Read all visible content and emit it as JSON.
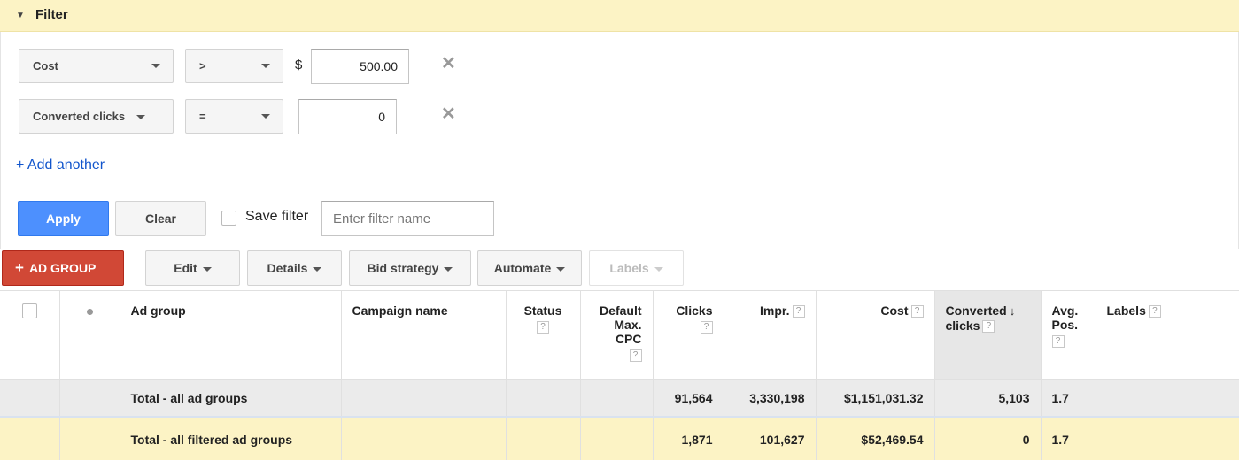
{
  "filter": {
    "title": "Filter",
    "rows": [
      {
        "field": "Cost",
        "operator": ">",
        "prefix": "$",
        "value": "500.00"
      },
      {
        "field": "Converted clicks",
        "operator": "=",
        "prefix": "",
        "value": "0"
      }
    ],
    "remove_glyph": "✕",
    "add_another": "+ Add another",
    "apply_label": "Apply",
    "clear_label": "Clear",
    "save_filter_label": "Save filter",
    "filter_name_placeholder": "Enter filter name"
  },
  "toolbar": {
    "add_ad_group": "AD GROUP",
    "add_icon": "+",
    "edit": "Edit",
    "details": "Details",
    "bid_strategy": "Bid strategy",
    "automate": "Automate",
    "labels": "Labels"
  },
  "table": {
    "columns": {
      "ad_group": "Ad group",
      "campaign_name": "Campaign name",
      "status": "Status",
      "default_max_cpc_1": "Default",
      "default_max_cpc_2": "Max.",
      "default_max_cpc_3": "CPC",
      "clicks": "Clicks",
      "impr": "Impr.",
      "cost": "Cost",
      "converted_clicks_1": "Converted",
      "converted_clicks_2": "clicks",
      "avg_pos_1": "Avg.",
      "avg_pos_2": "Pos.",
      "labels": "Labels",
      "help": "?",
      "sort_arrow": "↓"
    },
    "total_row": {
      "label": "Total - all ad groups",
      "clicks": "91,564",
      "impr": "3,330,198",
      "cost": "$1,151,031.32",
      "converted_clicks": "5,103",
      "avg_pos": "1.7"
    },
    "filtered_row": {
      "label": "Total - all filtered ad groups",
      "clicks": "1,871",
      "impr": "101,627",
      "cost": "$52,469.54",
      "converted_clicks": "0",
      "avg_pos": "1.7"
    }
  }
}
